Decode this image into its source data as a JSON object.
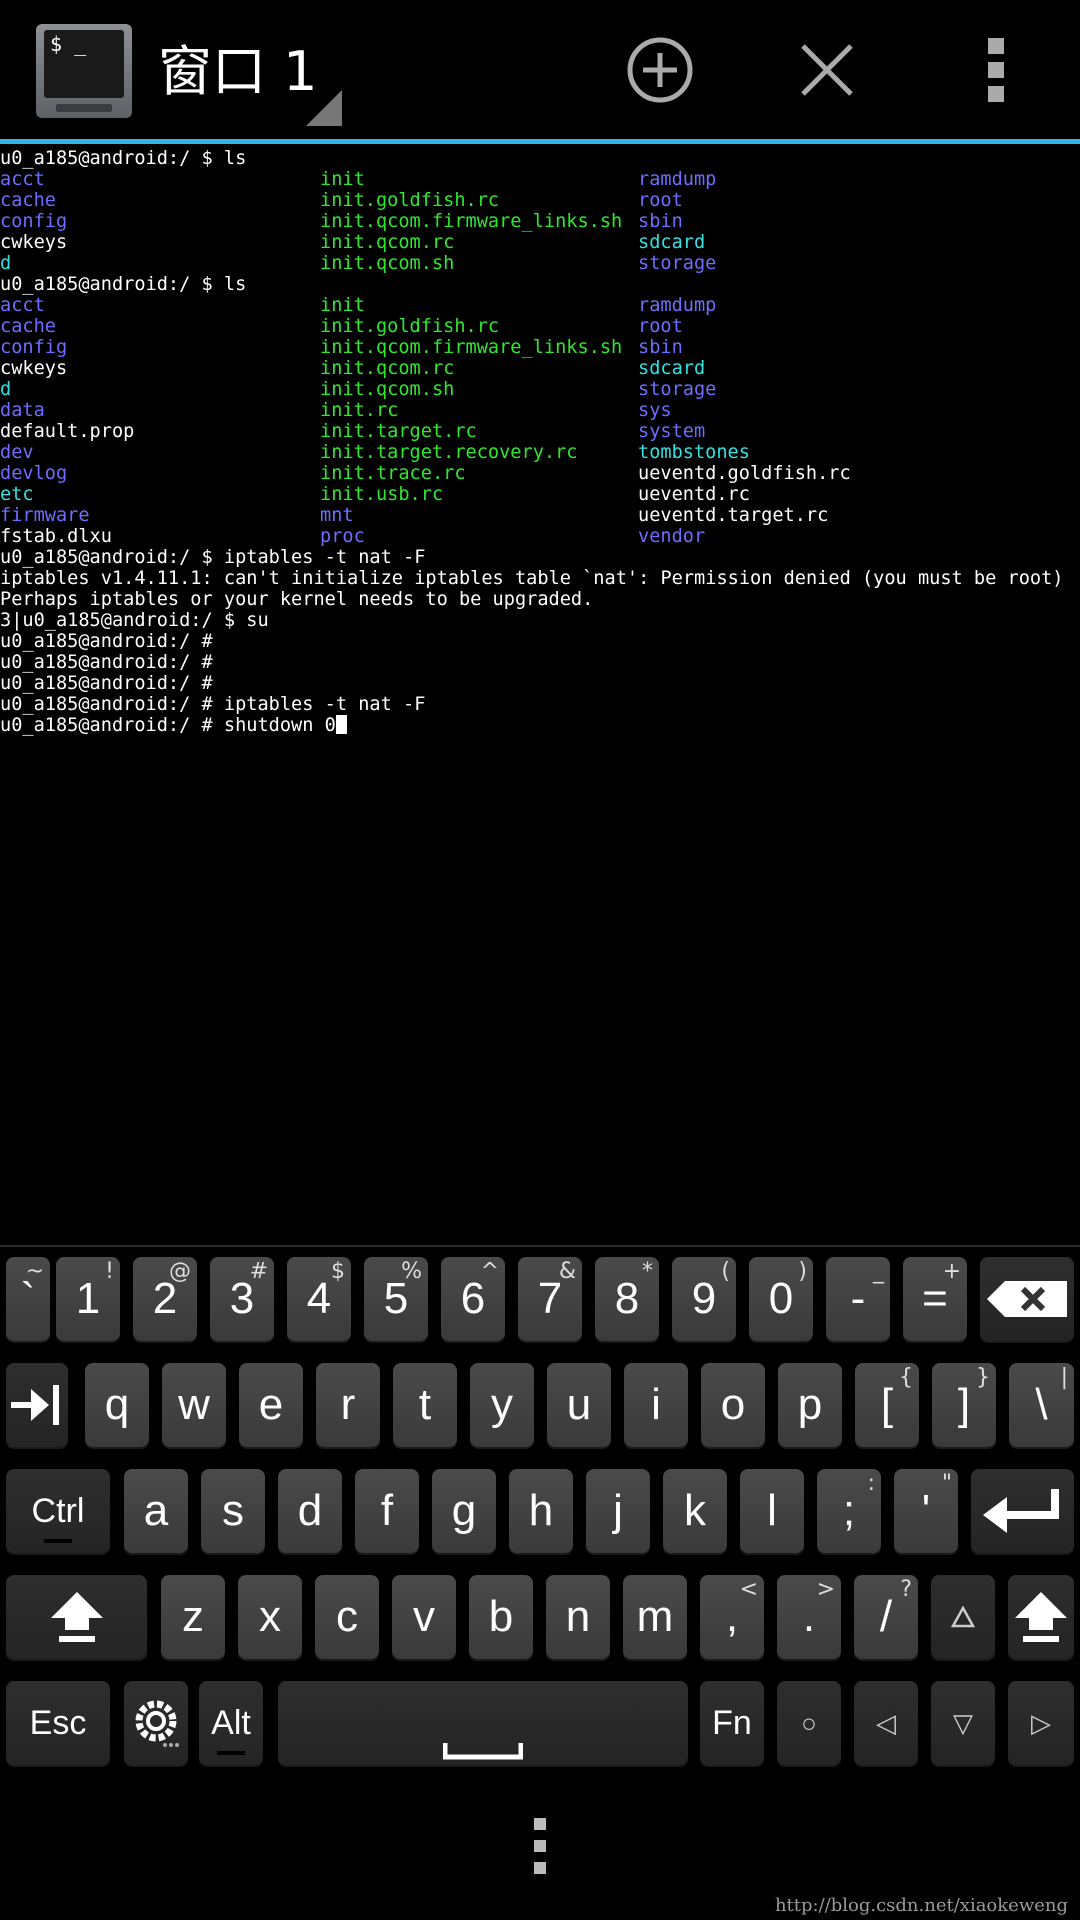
{
  "actionbar": {
    "title": "窗口 1",
    "app_icon_prompt": "$ _",
    "colors": {
      "divider": "#33b5e5"
    }
  },
  "colors": {
    "default": "#ffffff",
    "blue": "#6d6dff",
    "green": "#2ee82e",
    "cyan": "#33e0e0"
  },
  "terminal": {
    "lines": [
      [
        {
          "t": "u0_a185@android:/ $ ls",
          "c": "default"
        }
      ],
      [
        {
          "t": "acct",
          "c": "blue"
        },
        {
          "t": "init",
          "c": "green"
        },
        {
          "t": "ramdump",
          "c": "blue"
        }
      ],
      [
        {
          "t": "cache",
          "c": "blue"
        },
        {
          "t": "init.goldfish.rc",
          "c": "green"
        },
        {
          "t": "root",
          "c": "blue"
        }
      ],
      [
        {
          "t": "config",
          "c": "blue"
        },
        {
          "t": "init.qcom.firmware_links.sh",
          "c": "green"
        },
        {
          "t": "sbin",
          "c": "blue"
        }
      ],
      [
        {
          "t": "cwkeys",
          "c": "default"
        },
        {
          "t": "init.qcom.rc",
          "c": "green"
        },
        {
          "t": "sdcard",
          "c": "cyan"
        }
      ],
      [
        {
          "t": "d",
          "c": "cyan"
        },
        {
          "t": "init.qcom.sh",
          "c": "green"
        },
        {
          "t": "storage",
          "c": "blue"
        }
      ],
      [
        {
          "t": "u0_a185@android:/ $ ls",
          "c": "default"
        }
      ],
      [
        {
          "t": "acct",
          "c": "blue"
        },
        {
          "t": "init",
          "c": "green"
        },
        {
          "t": "ramdump",
          "c": "blue"
        }
      ],
      [
        {
          "t": "cache",
          "c": "blue"
        },
        {
          "t": "init.goldfish.rc",
          "c": "green"
        },
        {
          "t": "root",
          "c": "blue"
        }
      ],
      [
        {
          "t": "config",
          "c": "blue"
        },
        {
          "t": "init.qcom.firmware_links.sh",
          "c": "green"
        },
        {
          "t": "sbin",
          "c": "blue"
        }
      ],
      [
        {
          "t": "cwkeys",
          "c": "default"
        },
        {
          "t": "init.qcom.rc",
          "c": "green"
        },
        {
          "t": "sdcard",
          "c": "cyan"
        }
      ],
      [
        {
          "t": "d",
          "c": "cyan"
        },
        {
          "t": "init.qcom.sh",
          "c": "green"
        },
        {
          "t": "storage",
          "c": "blue"
        }
      ],
      [
        {
          "t": "data",
          "c": "blue"
        },
        {
          "t": "init.rc",
          "c": "green"
        },
        {
          "t": "sys",
          "c": "blue"
        }
      ],
      [
        {
          "t": "default.prop",
          "c": "default"
        },
        {
          "t": "init.target.rc",
          "c": "green"
        },
        {
          "t": "system",
          "c": "blue"
        }
      ],
      [
        {
          "t": "dev",
          "c": "blue"
        },
        {
          "t": "init.target.recovery.rc",
          "c": "green"
        },
        {
          "t": "tombstones",
          "c": "cyan"
        }
      ],
      [
        {
          "t": "devlog",
          "c": "blue"
        },
        {
          "t": "init.trace.rc",
          "c": "green"
        },
        {
          "t": "ueventd.goldfish.rc",
          "c": "default"
        }
      ],
      [
        {
          "t": "etc",
          "c": "cyan"
        },
        {
          "t": "init.usb.rc",
          "c": "green"
        },
        {
          "t": "ueventd.rc",
          "c": "default"
        }
      ],
      [
        {
          "t": "firmware",
          "c": "blue"
        },
        {
          "t": "mnt",
          "c": "blue"
        },
        {
          "t": "ueventd.target.rc",
          "c": "default"
        }
      ],
      [
        {
          "t": "fstab.dlxu",
          "c": "default"
        },
        {
          "t": "proc",
          "c": "blue"
        },
        {
          "t": "vendor",
          "c": "blue"
        }
      ],
      [
        {
          "t": "u0_a185@android:/ $ iptables -t nat -F",
          "c": "default"
        }
      ],
      [
        {
          "t": "iptables v1.4.11.1: can't initialize iptables table `nat': Permission denied (you must be root)",
          "c": "default"
        }
      ],
      [
        {
          "t": "Perhaps iptables or your kernel needs to be upgraded.",
          "c": "default"
        }
      ],
      [
        {
          "t": "3|u0_a185@android:/ $ su",
          "c": "default"
        }
      ],
      [
        {
          "t": "u0_a185@android:/ #",
          "c": "default"
        }
      ],
      [
        {
          "t": "u0_a185@android:/ #",
          "c": "default"
        }
      ],
      [
        {
          "t": "u0_a185@android:/ #",
          "c": "default"
        }
      ],
      [
        {
          "t": "u0_a185@android:/ # iptables -t nat -F",
          "c": "default"
        }
      ],
      [
        {
          "t": "u0_a185@android:/ # shutdown 0",
          "c": "default",
          "cursor": true
        }
      ]
    ]
  },
  "keyboard": {
    "rows": [
      [
        {
          "label": "`",
          "sec": "~",
          "name": "key-backtick"
        },
        {
          "label": "1",
          "sec": "!",
          "name": "key-1"
        },
        {
          "label": "2",
          "sec": "@",
          "name": "key-2"
        },
        {
          "label": "3",
          "sec": "#",
          "name": "key-3"
        },
        {
          "label": "4",
          "sec": "$",
          "name": "key-4"
        },
        {
          "label": "5",
          "sec": "%",
          "name": "key-5"
        },
        {
          "label": "6",
          "sec": "^",
          "name": "key-6"
        },
        {
          "label": "7",
          "sec": "&",
          "name": "key-7"
        },
        {
          "label": "8",
          "sec": "*",
          "name": "key-8"
        },
        {
          "label": "9",
          "sec": "(",
          "name": "key-9"
        },
        {
          "label": "0",
          "sec": ")",
          "name": "key-0"
        },
        {
          "label": "-",
          "sec": "_",
          "name": "key-minus"
        },
        {
          "label": "=",
          "sec": "+",
          "name": "key-equals"
        },
        {
          "icon": "backspace-icon",
          "name": "key-backspace",
          "dark": true
        }
      ],
      [
        {
          "icon": "tab-icon",
          "name": "key-tab",
          "dark": true
        },
        {
          "label": "q",
          "name": "key-q"
        },
        {
          "label": "w",
          "name": "key-w"
        },
        {
          "label": "e",
          "name": "key-e"
        },
        {
          "label": "r",
          "name": "key-r"
        },
        {
          "label": "t",
          "name": "key-t"
        },
        {
          "label": "y",
          "name": "key-y"
        },
        {
          "label": "u",
          "name": "key-u"
        },
        {
          "label": "i",
          "name": "key-i"
        },
        {
          "label": "o",
          "name": "key-o"
        },
        {
          "label": "p",
          "name": "key-p"
        },
        {
          "label": "[",
          "sec": "{",
          "name": "key-lbracket"
        },
        {
          "label": "]",
          "sec": "}",
          "name": "key-rbracket"
        },
        {
          "label": "\\",
          "sec": "|",
          "name": "key-backslash"
        }
      ],
      [
        {
          "label": "Ctrl",
          "name": "key-ctrl",
          "dark": true,
          "mod": true,
          "indicator": true
        },
        {
          "label": "a",
          "name": "key-a"
        },
        {
          "label": "s",
          "name": "key-s"
        },
        {
          "label": "d",
          "name": "key-d"
        },
        {
          "label": "f",
          "name": "key-f"
        },
        {
          "label": "g",
          "name": "key-g"
        },
        {
          "label": "h",
          "name": "key-h"
        },
        {
          "label": "j",
          "name": "key-j"
        },
        {
          "label": "k",
          "name": "key-k"
        },
        {
          "label": "l",
          "name": "key-l"
        },
        {
          "label": ";",
          "sec": ":",
          "name": "key-semicolon"
        },
        {
          "label": "'",
          "sec": "\"",
          "name": "key-quote"
        },
        {
          "icon": "enter-icon",
          "name": "key-enter",
          "dark": true
        }
      ],
      [
        {
          "icon": "shift-icon",
          "name": "key-shift-left",
          "dark": true
        },
        {
          "label": "z",
          "name": "key-z"
        },
        {
          "label": "x",
          "name": "key-x"
        },
        {
          "label": "c",
          "name": "key-c"
        },
        {
          "label": "v",
          "name": "key-v"
        },
        {
          "label": "b",
          "name": "key-b"
        },
        {
          "label": "n",
          "name": "key-n"
        },
        {
          "label": "m",
          "name": "key-m"
        },
        {
          "label": ",",
          "sec": "<",
          "name": "key-comma"
        },
        {
          "label": ".",
          "sec": ">",
          "name": "key-period"
        },
        {
          "label": "/",
          "sec": "?",
          "name": "key-slash"
        },
        {
          "icon": "arrow-up-icon",
          "name": "key-arrow-up",
          "dark": true
        },
        {
          "icon": "shift-icon",
          "name": "key-shift-right",
          "dark": true
        }
      ],
      [
        {
          "label": "Esc",
          "name": "key-esc",
          "dark": true,
          "mod": true
        },
        {
          "icon": "settings-icon",
          "name": "key-settings",
          "dark": true
        },
        {
          "label": "Alt",
          "name": "key-alt",
          "dark": true,
          "mod": true,
          "indicator": true
        },
        {
          "icon": "space-icon",
          "name": "key-space",
          "dark": true
        },
        {
          "label": "Fn",
          "name": "key-fn",
          "dark": true,
          "mod": true
        },
        {
          "label": "○",
          "name": "key-home",
          "dark": true,
          "small": true
        },
        {
          "label": "◁",
          "name": "key-arrow-left",
          "dark": true,
          "small": true
        },
        {
          "label": "▽",
          "name": "key-arrow-down",
          "dark": true,
          "small": true
        },
        {
          "label": "▷",
          "name": "key-arrow-right",
          "dark": true,
          "small": true
        }
      ]
    ]
  },
  "watermark": "http://blog.csdn.net/xiaokeweng"
}
